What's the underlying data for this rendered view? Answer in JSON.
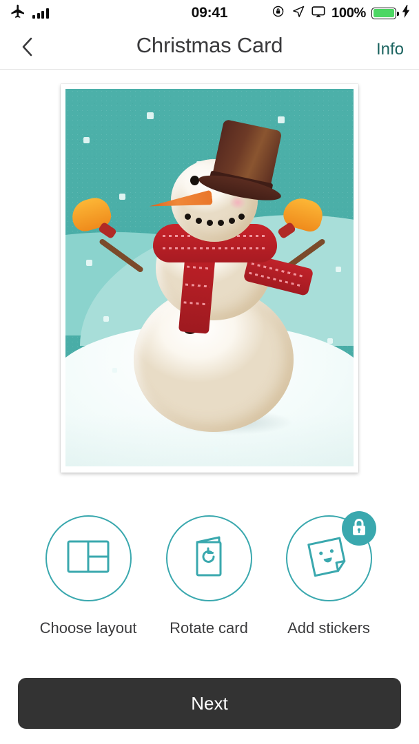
{
  "status_bar": {
    "airplane_icon": "airplane-icon",
    "signal_icon": "signal-bars-icon",
    "time": "09:41",
    "rotation_lock_icon": "rotation-lock-icon",
    "location_icon": "location-arrow-icon",
    "airplay_icon": "airplay-icon",
    "battery_percent": "100%",
    "battery_icon": "battery-icon",
    "charging_icon": "lightning-bolt-icon",
    "battery_color": "#4cd763"
  },
  "nav": {
    "back_icon": "chevron-left-icon",
    "title": "Christmas Card",
    "info_label": "Info",
    "info_color": "#1c6460"
  },
  "card_preview": {
    "name": "christmas-card-snowman-artwork",
    "description": "Illustrated snowman with brown top hat, carrot nose, red scarf and orange mittens on a teal snowy background",
    "background_color": "#4cb0a9",
    "snow_color": "#f2fbfa",
    "hat_color": "#5a2c20",
    "scarf_color": "#bf2027",
    "mitten_color": "#f0951f",
    "nose_color": "#e9762a"
  },
  "actions": [
    {
      "icon": "layout-grid-icon",
      "label": "Choose layout",
      "locked": false
    },
    {
      "icon": "rotate-card-icon",
      "label": "Rotate card",
      "locked": false
    },
    {
      "icon": "sticker-smiley-icon",
      "label": "Add stickers",
      "locked": true,
      "badge_icon": "lock-icon"
    }
  ],
  "footer": {
    "next_label": "Next",
    "next_bg": "#333333"
  },
  "theme": {
    "accent": "#3aa8ae"
  }
}
